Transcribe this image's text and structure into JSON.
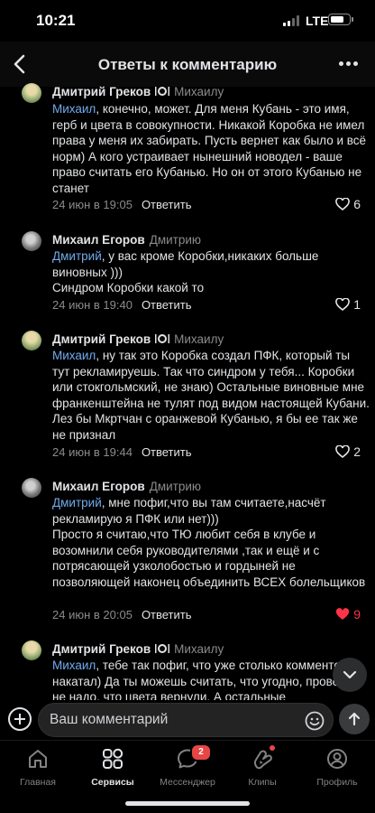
{
  "status": {
    "time": "10:21",
    "network": "LTE"
  },
  "header": {
    "title": "Ответы к комментарию"
  },
  "comments": [
    {
      "author": "Дмитрий Греков",
      "reply_to": "Михаилу",
      "mention": "Михаил",
      "text": ", конечно, может. Для меня Кубань - это имя, герб и цвета в совокупности. Никакой Коробка не имел права у меня их забирать. Пусть вернет как было и всё норм) А кого устраивает нынешний новодел - ваше право считать его Кубанью. Но он от этого Кубанью не станет",
      "time": "24 июн в 19:05",
      "reply_label": "Ответить",
      "likes": "6",
      "liked": false
    },
    {
      "author": "Михаил Егоров",
      "reply_to": "Дмитрию",
      "mention": "Дмитрий",
      "text": ", у вас кроме Коробки,никаких больше виновных )))\nСиндром Коробки какой то",
      "time": "24 июн в 19:40",
      "reply_label": "Ответить",
      "likes": "1",
      "liked": false
    },
    {
      "author": "Дмитрий Греков",
      "reply_to": "Михаилу",
      "mention": "Михаил",
      "text": ", ну так это Коробка создал ПФК, который ты тут рекламируешь. Так что синдром у тебя... Коробки или стокгольмский, не знаю) Остальные виновные мне франкенштейна не тулят под видом настоящей Кубани. Лез бы Мкртчан с оранжевой Кубанью, я бы ее так же не признал",
      "time": "24 июн в 19:44",
      "reply_label": "Ответить",
      "likes": "2",
      "liked": false
    },
    {
      "author": "Михаил Егоров",
      "reply_to": "Дмитрию",
      "mention": "Дмитрий",
      "text": ", мне пофиг,что вы там считаете,насчёт рекламирую я ПФК или нет)))\nПросто я считаю,что ТЮ любит себя в клубе и возомнили себя руководителями ,так и ещё и с потрясающей узколобостью и гордыней не позволяющей наконец объединить ВСЕХ болельщиков",
      "time": "24 июн в 20:05",
      "reply_label": "Ответить",
      "likes": "9",
      "liked": true
    },
    {
      "author": "Дмитрий Греков",
      "reply_to": "Михаилу",
      "mention": "Михаил",
      "text": ", тебе так пофиг, что уже столько комментов накатал) Да ты можешь считать, что угодно, проверять не надо, что цвета вернули. А остальные",
      "time": "",
      "reply_label": "",
      "likes": "",
      "liked": false
    }
  ],
  "composer": {
    "placeholder": "Ваш комментарий"
  },
  "tabs": [
    {
      "label": "Главная",
      "icon": "home-icon",
      "active": false
    },
    {
      "label": "Сервисы",
      "icon": "services-icon",
      "active": true
    },
    {
      "label": "Мессенджер",
      "icon": "messenger-icon",
      "active": false,
      "badge": "2"
    },
    {
      "label": "Клипы",
      "icon": "clips-icon",
      "active": false
    },
    {
      "label": "Профиль",
      "icon": "profile-icon",
      "active": false
    }
  ],
  "colors": {
    "accent": "#71aaeb",
    "like": "#ff3347",
    "badge": "#e64646",
    "background": "#000000"
  }
}
